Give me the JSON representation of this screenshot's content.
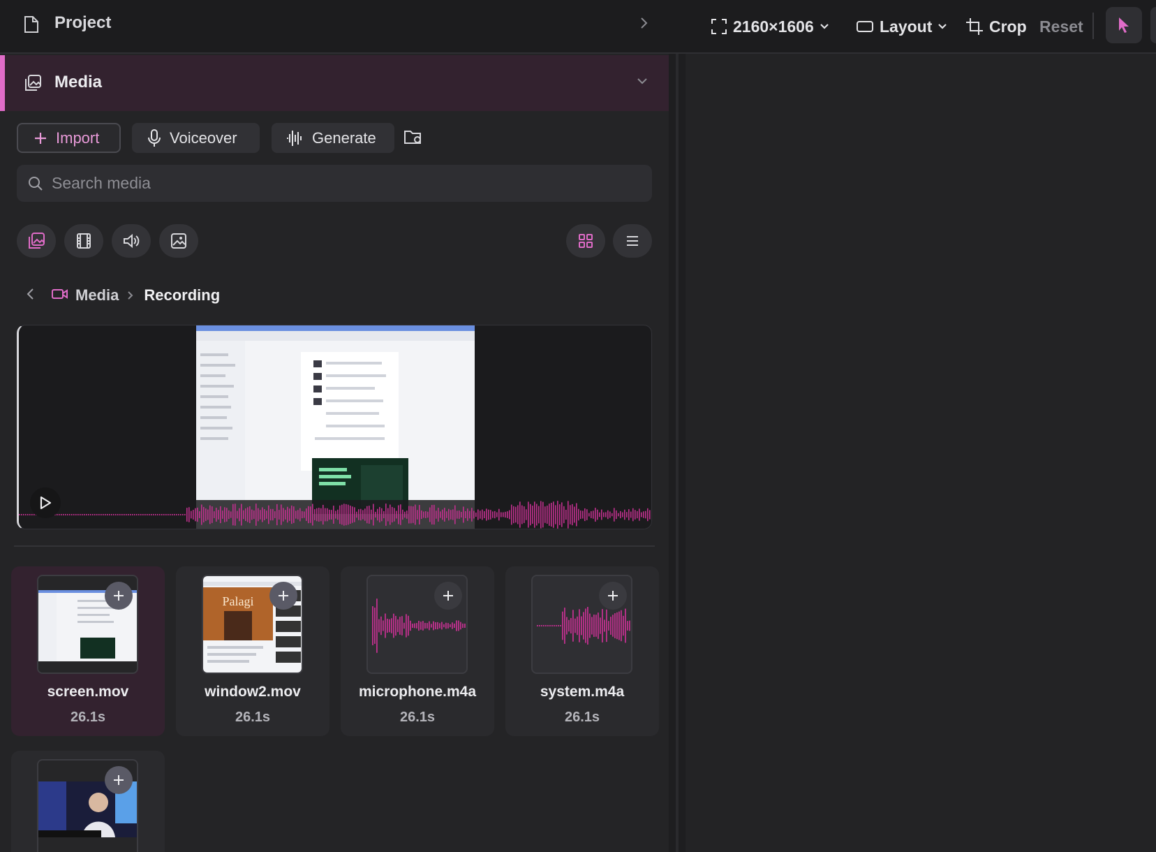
{
  "project": {
    "title": "Project"
  },
  "media_section": {
    "title": "Media"
  },
  "toolbar": {
    "import_label": "Import",
    "voiceover_label": "Voiceover",
    "generate_label": "Generate"
  },
  "search": {
    "placeholder": "Search media"
  },
  "filters": [
    "all-media-icon",
    "video-icon",
    "audio-icon",
    "image-icon"
  ],
  "view_modes": [
    "grid-icon",
    "list-icon"
  ],
  "breadcrumb": {
    "root": "Media",
    "current": "Recording"
  },
  "canvas_toolbar": {
    "size_label": "2160×1606",
    "layout_label": "Layout",
    "crop_label": "Crop",
    "reset_label": "Reset"
  },
  "media_items": [
    {
      "name": "screen.mov",
      "duration": "26.1s",
      "type": "video",
      "selected": true
    },
    {
      "name": "window2.mov",
      "duration": "26.1s",
      "type": "video",
      "selected": false
    },
    {
      "name": "microphone.m4a",
      "duration": "26.1s",
      "type": "audio",
      "selected": false
    },
    {
      "name": "system.m4a",
      "duration": "26.1s",
      "type": "audio",
      "selected": false
    },
    {
      "name": "",
      "duration": "",
      "type": "video",
      "selected": false
    }
  ],
  "colors": {
    "accent": "#e06cc8",
    "wave": "#c0308e",
    "bg": "#242426"
  }
}
